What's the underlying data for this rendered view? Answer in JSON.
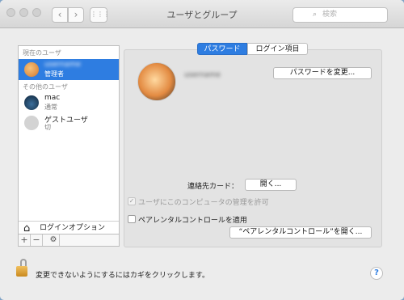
{
  "window": {
    "title": "ユーザとグループ"
  },
  "toolbar": {
    "back": "‹",
    "forward": "›",
    "grid": "⋮⋮⋮",
    "search_placeholder": "検索"
  },
  "sidebar": {
    "current_section": "現在のユーザ",
    "current_user": {
      "name": "username",
      "role": "管理者"
    },
    "other_section": "その他のユーザ",
    "other_users": [
      {
        "name": "mac",
        "role": "通常"
      },
      {
        "name": "ゲストユーザ",
        "role": "切"
      }
    ],
    "login_options": "ログインオプション",
    "add": "+",
    "remove": "−",
    "gear": "⚙"
  },
  "tabs": [
    "パスワード",
    "ログイン項目"
  ],
  "main": {
    "username": "username",
    "change_password": "パスワードを変更...",
    "contacts_card_label": "連絡先カード：",
    "open_button": "開く...",
    "admin_allow": "ユーザにこのコンピュータの管理を許可",
    "parental_enable": "ペアレンタルコントロールを適用",
    "parental_open": "“ペアレンタルコントロール”を開く..."
  },
  "footer": {
    "lock_text": "変更できないようにするにはカギをクリックします。",
    "help": "?"
  }
}
